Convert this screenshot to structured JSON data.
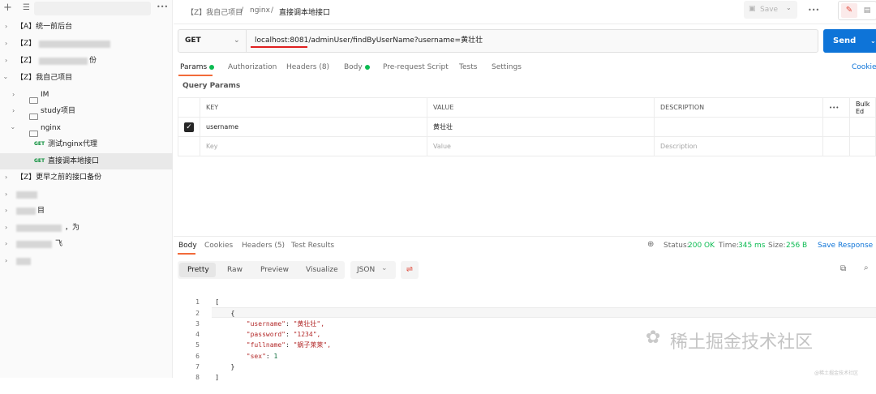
{
  "sidebar": {
    "items": [
      {
        "label": "【A】统一前后台"
      },
      {
        "label": "【Z】"
      },
      {
        "label": "【Z】",
        "suffix": "份"
      },
      {
        "label": "【Z】我自己项目"
      },
      {
        "label": "IM"
      },
      {
        "label": "study项目"
      },
      {
        "label": "nginx"
      },
      {
        "method": "GET",
        "label": "测试nginx代理"
      },
      {
        "method": "GET",
        "label": "直接调本地接口"
      },
      {
        "label": "【Z】更早之前的接口备份"
      },
      {
        "label": ""
      },
      {
        "label": "目"
      },
      {
        "label": "，为"
      },
      {
        "label": "飞"
      },
      {
        "label": ""
      }
    ]
  },
  "header": {
    "breadcrumb_1": "【Z】我自己项目",
    "sep": "/",
    "breadcrumb_2": "nginx",
    "sep2": "/",
    "title": "直接调本地接口",
    "save": "Save",
    "more": "•••"
  },
  "request": {
    "method": "GET",
    "url": "localhost:8081/adminUser/findByUserName?username=黄壮壮",
    "send": "Send"
  },
  "tabs": [
    "Params",
    "Authorization",
    "Headers (8)",
    "Body",
    "Pre-request Script",
    "Tests",
    "Settings"
  ],
  "cookies": "Cookie",
  "query_params": "Query Params",
  "table": {
    "headers": [
      "KEY",
      "VALUE",
      "DESCRIPTION",
      "•••",
      "Bulk Ed"
    ],
    "rows": [
      {
        "key": "username",
        "value": "黄壮壮",
        "description": ""
      }
    ],
    "placeholders": [
      "Key",
      "Value",
      "Description"
    ]
  },
  "response": {
    "tabs": [
      "Body",
      "Cookies",
      "Headers (5)",
      "Test Results"
    ],
    "status_label": "Status:",
    "status": "200 OK",
    "time_label": "Time:",
    "time": "345 ms",
    "size_label": "Size:",
    "size": "256 B",
    "save": "Save Response"
  },
  "format": {
    "tabs": [
      "Pretty",
      "Raw",
      "Preview",
      "Visualize"
    ],
    "type": "JSON"
  },
  "code": [
    {
      "n": "1",
      "t": "["
    },
    {
      "n": "2",
      "t": "    {"
    },
    {
      "n": "3",
      "k": "\"username\"",
      "v": "\"黄壮壮\","
    },
    {
      "n": "4",
      "k": "\"password\"",
      "v": "\"1234\","
    },
    {
      "n": "5",
      "k": "\"fullname\"",
      "v": "\"蜗子莱莱\","
    },
    {
      "n": "6",
      "k": "\"sex\"",
      "v": "1"
    },
    {
      "n": "7",
      "t": "    }"
    },
    {
      "n": "8",
      "t": "]"
    }
  ],
  "watermark": "稀土掘金技术社区",
  "watermark_small": "@稀土掘金技术社区"
}
